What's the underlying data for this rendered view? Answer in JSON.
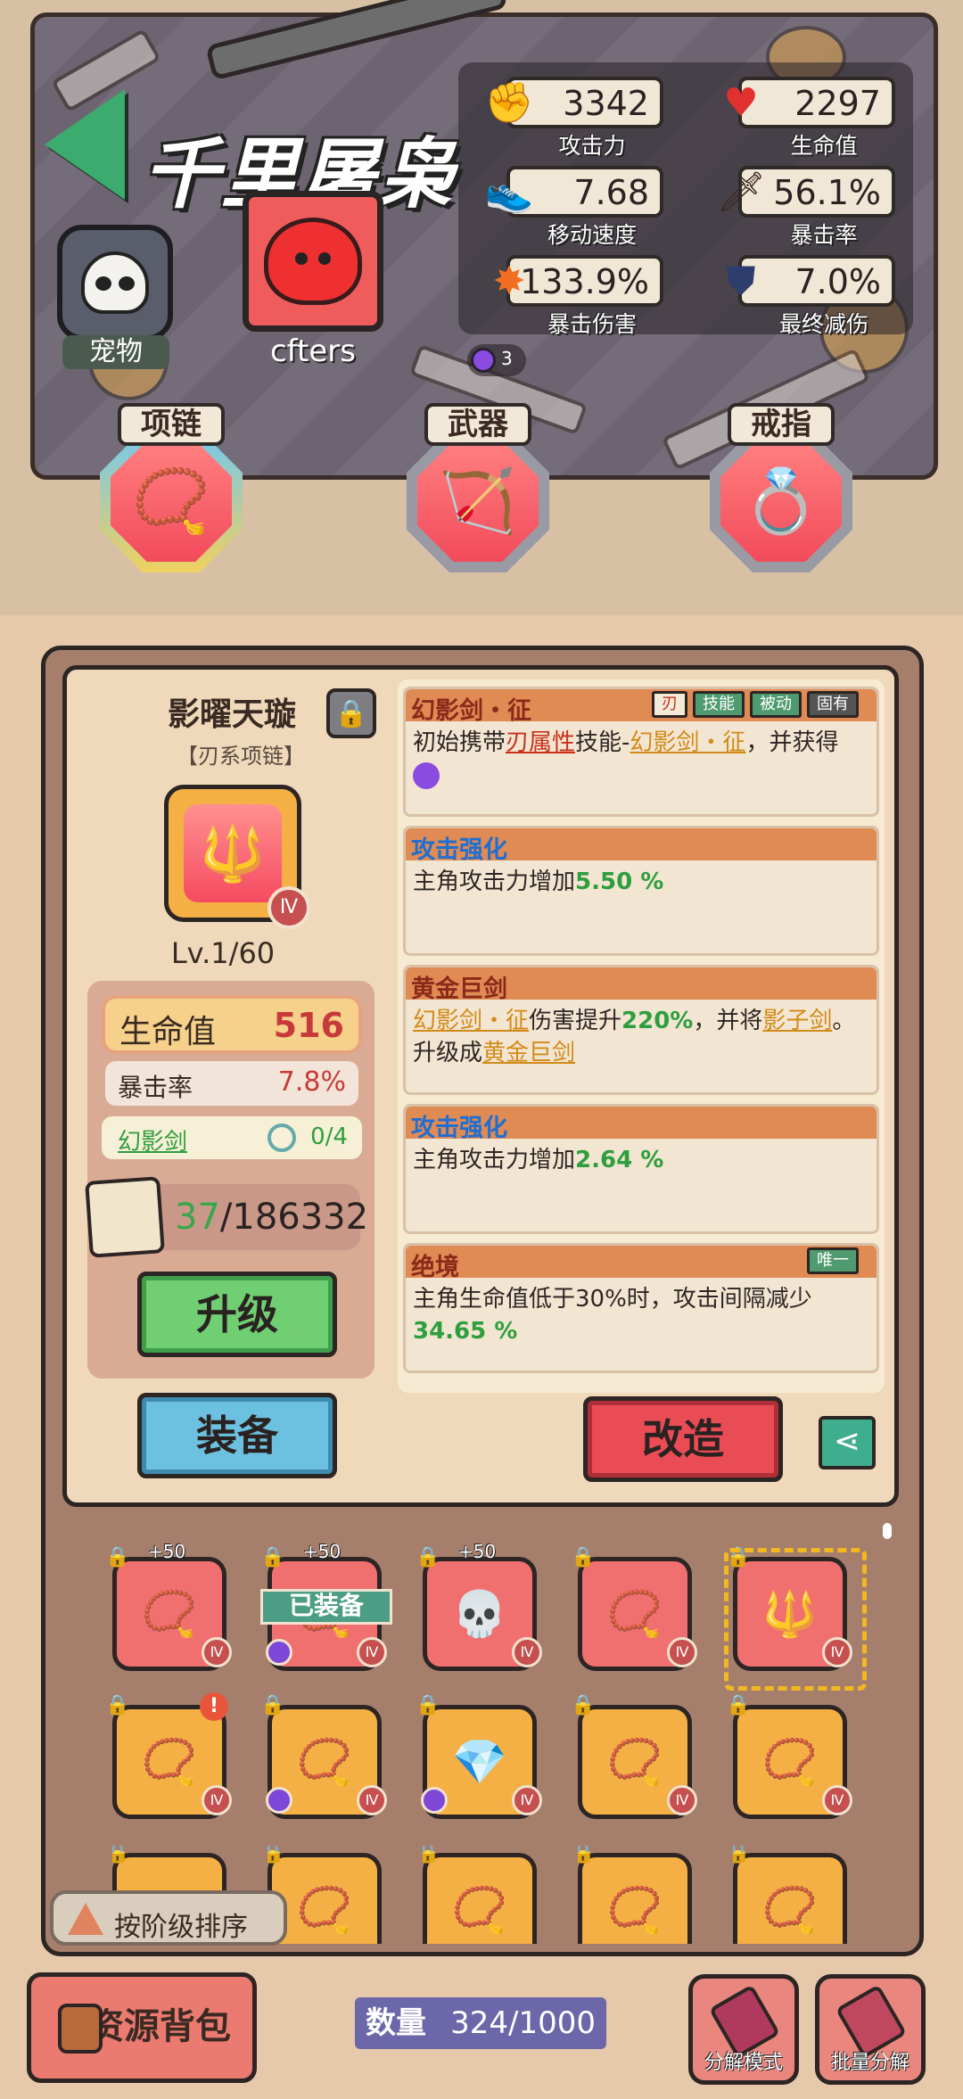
{
  "header": {
    "title": "千里屠枭",
    "pet_label": "宠物",
    "username": "cfters",
    "gem_count": "3"
  },
  "stats": [
    {
      "icon": "fist-icon",
      "value": "3342",
      "label": "攻击力"
    },
    {
      "icon": "heart-icon",
      "value": "2297",
      "label": "生命值"
    },
    {
      "icon": "sneaker-icon",
      "value": "7.68",
      "label": "移动速度"
    },
    {
      "icon": "sword-icon",
      "value": "56.1%",
      "label": "暴击率"
    },
    {
      "icon": "explosion-icon",
      "value": "133.9%",
      "label": "暴击伤害"
    },
    {
      "icon": "shield-icon",
      "value": "7.0%",
      "label": "最终减伤"
    }
  ],
  "slots": [
    {
      "label": "项链",
      "icon": "necklace-icon",
      "selected": true
    },
    {
      "label": "武器",
      "icon": "bow-icon",
      "selected": false
    },
    {
      "label": "戒指",
      "icon": "ring-icon",
      "selected": false
    }
  ],
  "item": {
    "name": "影曜天璇",
    "type": "【刃系项链】",
    "tier": "Ⅳ",
    "level": "Lv.1/60",
    "hp_label": "生命值",
    "hp_value": "516",
    "crit_label": "暴击率",
    "crit_value": "7.8%",
    "skill_name": "幻影剑",
    "skill_progress": "0/4",
    "material_have": "37",
    "material_need": "/186332",
    "upgrade_label": "升级",
    "equip_label": "装备",
    "reforge_label": "改造"
  },
  "affixes": [
    {
      "title": "幻影剑・征",
      "badges": [
        "刃",
        "技能",
        "被动",
        "固有"
      ],
      "text_a": "初始携带",
      "text_b": "刃属性",
      "text_c": "技能-",
      "text_d": "幻影剑・征",
      "text_e": "，并获得"
    },
    {
      "title": "攻击强化",
      "text_a": "主角攻击力增加",
      "value": "5.50 %"
    },
    {
      "title": "黄金巨剑",
      "text_a": "幻影剑・征",
      "text_b": "伤害提升",
      "value": "220%",
      "text_c": "，并将",
      "text_d": "影子剑",
      "text_e": "。",
      "text_f": "升级成",
      "text_g": "黄金巨剑"
    },
    {
      "title": "攻击强化",
      "text_a": "主角攻击力增加",
      "value": "2.64 %"
    },
    {
      "title": "绝境",
      "badge": "唯一",
      "text_a": "主角生命值低于30%时，攻击间隔减少",
      "value": "34.65 %"
    }
  ],
  "inventory": {
    "row1": [
      {
        "plus": "+50",
        "tier": "Ⅳ",
        "red": true
      },
      {
        "plus": "+50",
        "tier": "Ⅳ",
        "red": true,
        "equipped": "已装备",
        "purple": true
      },
      {
        "plus": "+50",
        "tier": "Ⅳ",
        "red": true
      },
      {
        "tier": "Ⅳ",
        "red": true
      },
      {
        "tier": "Ⅳ",
        "red": true,
        "selected": true
      }
    ],
    "row2": [
      {
        "tier": "Ⅳ",
        "alert": "!"
      },
      {
        "tier": "Ⅳ",
        "purple": true
      },
      {
        "tier": "Ⅳ",
        "purple": true
      },
      {
        "tier": "Ⅳ"
      },
      {
        "tier": "Ⅳ"
      }
    ]
  },
  "sort_label": "按阶级排序",
  "footer": {
    "resource_label": "资源背包",
    "count_key": "数量",
    "count_value": "324/1000",
    "decompose_label": "分解模式",
    "batch_label": "批量分解"
  }
}
